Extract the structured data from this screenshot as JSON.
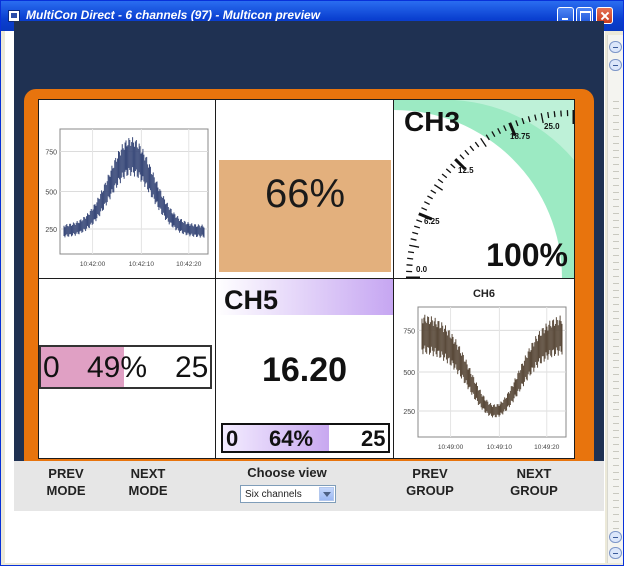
{
  "window": {
    "title": "MultiCon Direct - 6 channels (97) - Multicon preview"
  },
  "channels": {
    "ch1": {
      "y_ticks": [
        "750",
        "500",
        "250"
      ],
      "x_ticks": [
        "10:42:00",
        "10:42:10",
        "10:42:20"
      ]
    },
    "ch2": {
      "value_text": "66%",
      "level": 0.66
    },
    "ch3": {
      "label": "CH3",
      "value_text": "100%",
      "dial_labels": [
        "25.0",
        "18.75",
        "12.5",
        "6.25",
        "0.0"
      ]
    },
    "ch4": {
      "min": "0",
      "value_text": "49%",
      "max": "25",
      "level": 0.49
    },
    "ch5": {
      "label": "CH5",
      "value": "16.20",
      "bar_min": "0",
      "bar_text": "64%",
      "bar_max": "25",
      "level": 0.64
    },
    "ch6": {
      "title": "CH6",
      "y_ticks": [
        "750",
        "500",
        "250"
      ],
      "x_ticks": [
        "10:49:00",
        "10:49:10",
        "10:49:20"
      ]
    }
  },
  "controls": {
    "prev_mode": [
      "PREV",
      "MODE"
    ],
    "next_mode": [
      "NEXT",
      "MODE"
    ],
    "choose_view_label": "Choose view",
    "view_selected": "Six channels",
    "prev_group": [
      "PREV",
      "GROUP"
    ],
    "next_group": [
      "NEXT",
      "GROUP"
    ]
  },
  "colors": {
    "frame": "#e8740d",
    "background": "#1f3152",
    "ch2_fill": "#e3b07d",
    "ch3_accent": "#7fe0b0",
    "ch4_fill": "#e0a0c4",
    "ch5_accent": "#c8a8f0",
    "trace": "#3a4a7a",
    "trace_ch6": "#5a4a3a"
  },
  "icons": [
    "app-window-icon",
    "minimize-icon",
    "maximize-icon",
    "close-icon",
    "dropdown-arrow-icon",
    "scroll-up-icon",
    "scroll-down-icon"
  ]
}
